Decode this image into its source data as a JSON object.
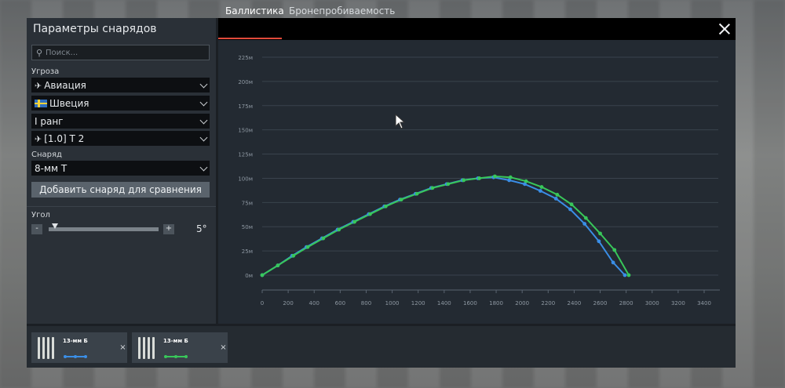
{
  "panel": {
    "title": "Параметры снарядов",
    "search_placeholder": "Поиск...",
    "threat_label": "Угроза",
    "threat_select": "Авиация",
    "nation_select": "Швеция",
    "rank_select": "I ранг",
    "vehicle_select": "[1.0] T 2",
    "shell_label": "Снаряд",
    "shell_select": "8-мм T",
    "add_button": "Добавить снаряд для сравнения",
    "angle_label": "Угол",
    "minus": "-",
    "plus": "+",
    "angle_value": "5°"
  },
  "tabs": [
    {
      "label": "Баллистика",
      "active": true
    },
    {
      "label": "Бронепробиваемость",
      "active": false
    }
  ],
  "compare": [
    {
      "name": "13-мм Б",
      "color": "#3a8ee6",
      "remove": "×"
    },
    {
      "name": "13-мм Б",
      "color": "#38c75a",
      "remove": "×"
    }
  ],
  "chart_data": {
    "type": "line",
    "x_ticks": [
      "0",
      "200",
      "400",
      "600",
      "800",
      "1000",
      "1200",
      "1400",
      "1600",
      "1800",
      "2000",
      "2200",
      "2400",
      "2600",
      "2800",
      "3000",
      "3200",
      "3400"
    ],
    "y_ticks": [
      "0м",
      "25м",
      "50м",
      "75м",
      "100м",
      "125м",
      "150м",
      "175м",
      "200м",
      "225м"
    ],
    "xlim": [
      0,
      3400
    ],
    "ylim": [
      0,
      225
    ],
    "grid": true,
    "series": [
      {
        "color": "#3a8ee6",
        "x": [
          0,
          120,
          230,
          340,
          460,
          580,
          700,
          820,
          940,
          1060,
          1180,
          1300,
          1420,
          1540,
          1660,
          1780,
          1900,
          2020,
          2140,
          2260,
          2370,
          2480,
          2590,
          2700,
          2790
        ],
        "y": [
          0,
          10,
          20,
          29,
          38,
          47,
          55,
          63,
          71,
          78,
          84,
          90,
          94,
          98,
          100,
          101,
          98,
          94,
          87,
          79,
          68,
          53,
          35,
          13,
          0
        ]
      },
      {
        "color": "#38c75a",
        "x": [
          0,
          120,
          240,
          350,
          470,
          590,
          710,
          830,
          950,
          1070,
          1190,
          1310,
          1430,
          1550,
          1670,
          1790,
          1910,
          2030,
          2150,
          2270,
          2380,
          2490,
          2600,
          2710,
          2820
        ],
        "y": [
          0,
          10,
          20,
          29,
          38,
          47,
          55,
          63,
          71,
          78,
          84,
          90,
          94,
          98,
          100,
          102,
          101,
          97,
          91,
          83,
          73,
          59,
          43,
          26,
          0
        ]
      }
    ]
  }
}
